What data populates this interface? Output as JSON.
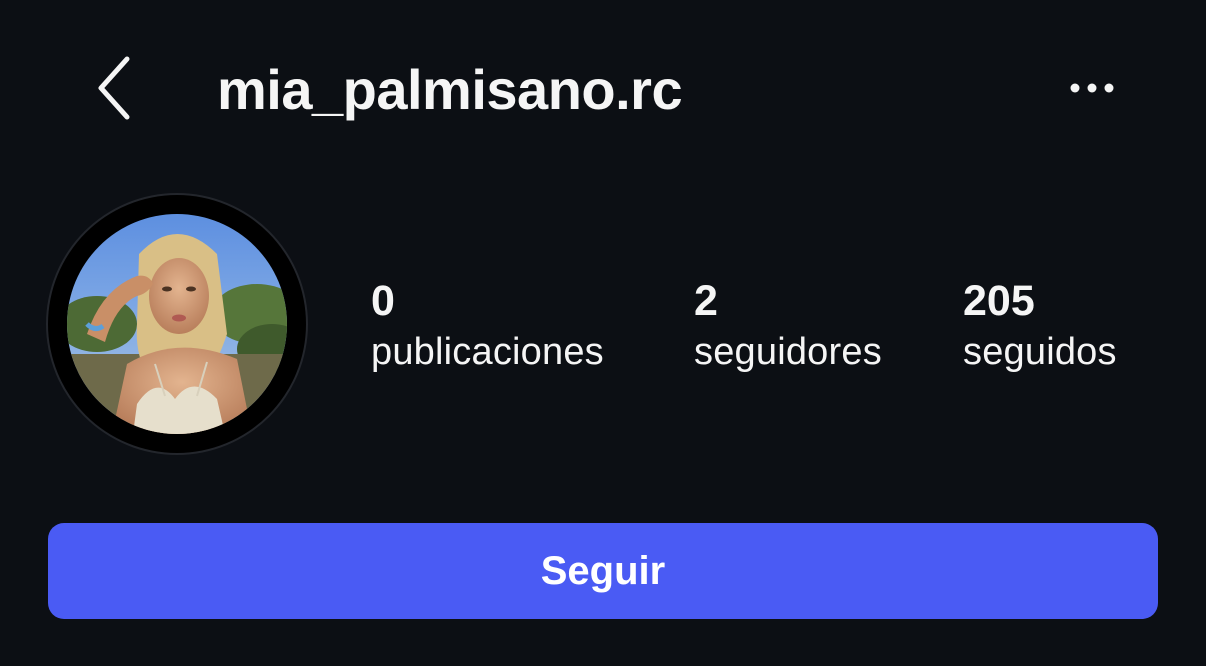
{
  "header": {
    "username": "mia_palmisano.rc",
    "back_icon": "chevron-left-icon",
    "more_icon": "more-horizontal-icon"
  },
  "profile": {
    "avatar": "profile-photo",
    "stats": [
      {
        "value": "0",
        "label": "publicaciones"
      },
      {
        "value": "2",
        "label": "seguidores"
      },
      {
        "value": "205",
        "label": "seguidos"
      }
    ]
  },
  "actions": {
    "follow_label": "Seguir"
  },
  "colors": {
    "background": "#0c0f14",
    "accent": "#4a5bf4",
    "text": "#f5f5f5"
  }
}
